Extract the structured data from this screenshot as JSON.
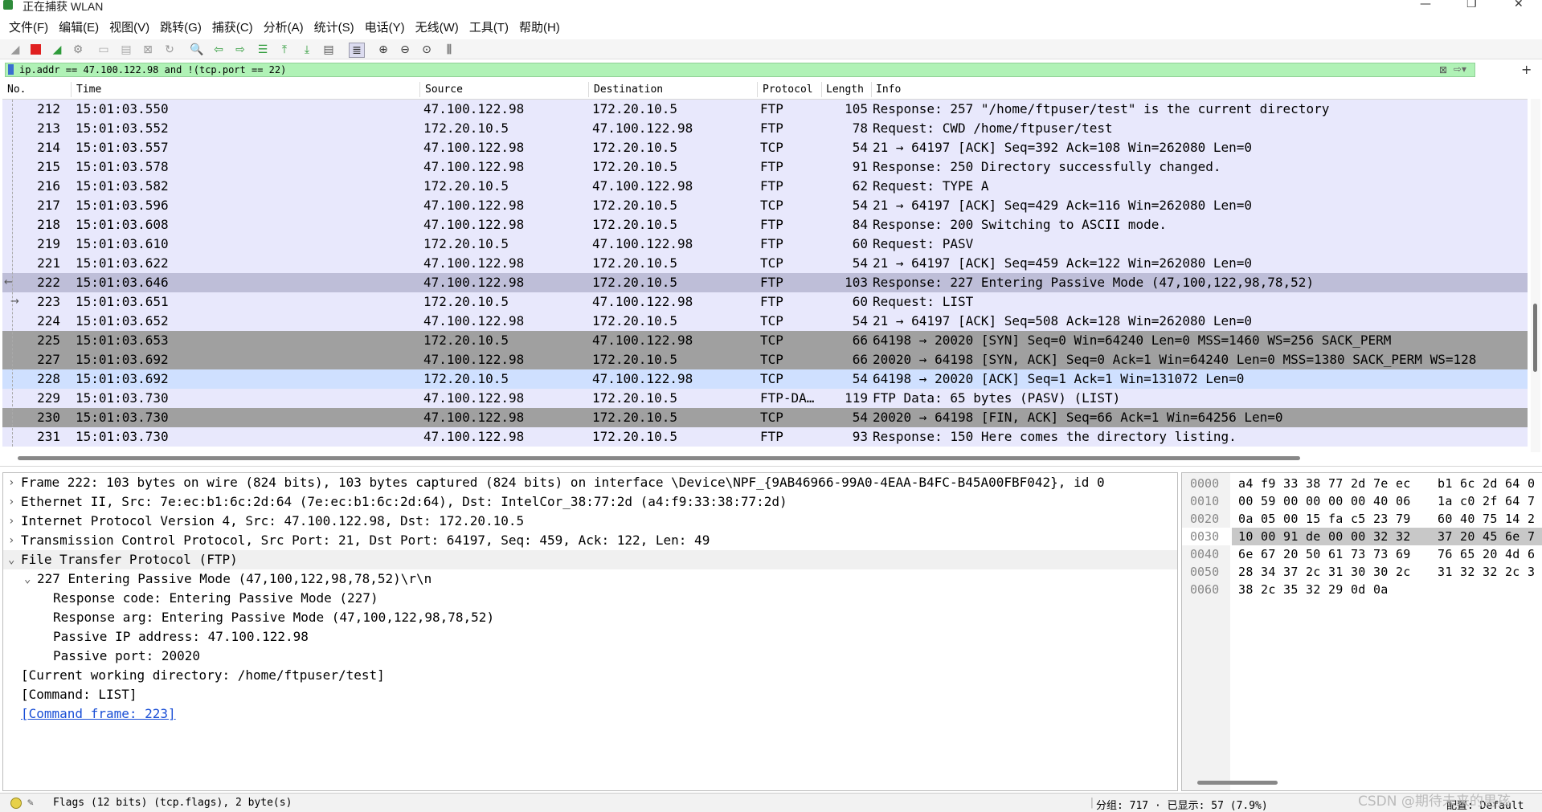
{
  "window": {
    "title": "正在捕获 WLAN",
    "minimize": "—",
    "maximize": "❐",
    "close": "✕"
  },
  "menu": [
    "文件(F)",
    "编辑(E)",
    "视图(V)",
    "跳转(G)",
    "捕获(C)",
    "分析(A)",
    "统计(S)",
    "电话(Y)",
    "无线(W)",
    "工具(T)",
    "帮助(H)"
  ],
  "filter": {
    "value": "ip.addr == 47.100.122.98 and !(tcp.port == 22)",
    "clear_icon": "⊠",
    "apply_icon": "⇨▾",
    "add": "+"
  },
  "columns": {
    "no": "No.",
    "time": "Time",
    "source": "Source",
    "destination": "Destination",
    "protocol": "Protocol",
    "length": "Length",
    "info": "Info"
  },
  "packets": [
    {
      "no": "212",
      "time": "15:01:03.550",
      "src": "47.100.122.98",
      "dst": "172.20.10.5",
      "proto": "FTP",
      "len": "105",
      "info": "Response: 257 \"/home/ftpuser/test\" is the current directory",
      "style": "ftp"
    },
    {
      "no": "213",
      "time": "15:01:03.552",
      "src": "172.20.10.5",
      "dst": "47.100.122.98",
      "proto": "FTP",
      "len": "78",
      "info": "Request: CWD /home/ftpuser/test",
      "style": "ftp"
    },
    {
      "no": "214",
      "time": "15:01:03.557",
      "src": "47.100.122.98",
      "dst": "172.20.10.5",
      "proto": "TCP",
      "len": "54",
      "info": "21 → 64197 [ACK] Seq=392 Ack=108 Win=262080 Len=0",
      "style": "ftp"
    },
    {
      "no": "215",
      "time": "15:01:03.578",
      "src": "47.100.122.98",
      "dst": "172.20.10.5",
      "proto": "FTP",
      "len": "91",
      "info": "Response: 250 Directory successfully changed.",
      "style": "ftp"
    },
    {
      "no": "216",
      "time": "15:01:03.582",
      "src": "172.20.10.5",
      "dst": "47.100.122.98",
      "proto": "FTP",
      "len": "62",
      "info": "Request: TYPE A",
      "style": "ftp"
    },
    {
      "no": "217",
      "time": "15:01:03.596",
      "src": "47.100.122.98",
      "dst": "172.20.10.5",
      "proto": "TCP",
      "len": "54",
      "info": "21 → 64197 [ACK] Seq=429 Ack=116 Win=262080 Len=0",
      "style": "ftp"
    },
    {
      "no": "218",
      "time": "15:01:03.608",
      "src": "47.100.122.98",
      "dst": "172.20.10.5",
      "proto": "FTP",
      "len": "84",
      "info": "Response: 200 Switching to ASCII mode.",
      "style": "ftp"
    },
    {
      "no": "219",
      "time": "15:01:03.610",
      "src": "172.20.10.5",
      "dst": "47.100.122.98",
      "proto": "FTP",
      "len": "60",
      "info": "Request: PASV",
      "style": "ftp"
    },
    {
      "no": "221",
      "time": "15:01:03.622",
      "src": "47.100.122.98",
      "dst": "172.20.10.5",
      "proto": "TCP",
      "len": "54",
      "info": "21 → 64197 [ACK] Seq=459 Ack=122 Win=262080 Len=0",
      "style": "ftp"
    },
    {
      "no": "222",
      "time": "15:01:03.646",
      "src": "47.100.122.98",
      "dst": "172.20.10.5",
      "proto": "FTP",
      "len": "103",
      "info": "Response: 227 Entering Passive Mode (47,100,122,98,78,52)",
      "style": "selected"
    },
    {
      "no": "223",
      "time": "15:01:03.651",
      "src": "172.20.10.5",
      "dst": "47.100.122.98",
      "proto": "FTP",
      "len": "60",
      "info": "Request: LIST",
      "style": "ftp"
    },
    {
      "no": "224",
      "time": "15:01:03.652",
      "src": "47.100.122.98",
      "dst": "172.20.10.5",
      "proto": "TCP",
      "len": "54",
      "info": "21 → 64197 [ACK] Seq=508 Ack=128 Win=262080 Len=0",
      "style": "ftp"
    },
    {
      "no": "225",
      "time": "15:01:03.653",
      "src": "172.20.10.5",
      "dst": "47.100.122.98",
      "proto": "TCP",
      "len": "66",
      "info": "64198 → 20020 [SYN] Seq=0 Win=64240 Len=0 MSS=1460 WS=256 SACK_PERM",
      "style": "syn"
    },
    {
      "no": "227",
      "time": "15:01:03.692",
      "src": "47.100.122.98",
      "dst": "172.20.10.5",
      "proto": "TCP",
      "len": "66",
      "info": "20020 → 64198 [SYN, ACK] Seq=0 Ack=1 Win=64240 Len=0 MSS=1380 SACK_PERM WS=128",
      "style": "syn"
    },
    {
      "no": "228",
      "time": "15:01:03.692",
      "src": "172.20.10.5",
      "dst": "47.100.122.98",
      "proto": "TCP",
      "len": "54",
      "info": "64198 → 20020 [ACK] Seq=1 Ack=1 Win=131072 Len=0",
      "style": "tcp"
    },
    {
      "no": "229",
      "time": "15:01:03.730",
      "src": "47.100.122.98",
      "dst": "172.20.10.5",
      "proto": "FTP-DA…",
      "len": "119",
      "info": "FTP Data: 65 bytes (PASV) (LIST)",
      "style": "ftp"
    },
    {
      "no": "230",
      "time": "15:01:03.730",
      "src": "47.100.122.98",
      "dst": "172.20.10.5",
      "proto": "TCP",
      "len": "54",
      "info": "20020 → 64198 [FIN, ACK] Seq=66 Ack=1 Win=64256 Len=0",
      "style": "syn"
    },
    {
      "no": "231",
      "time": "15:01:03.730",
      "src": "47.100.122.98",
      "dst": "172.20.10.5",
      "proto": "FTP",
      "len": "93",
      "info": "Response: 150 Here comes the directory listing.",
      "style": "ftp"
    }
  ],
  "details": [
    {
      "arrow": "›",
      "indent": 0,
      "text": "Frame 222: 103 bytes on wire (824 bits), 103 bytes captured (824 bits) on interface \\Device\\NPF_{9AB46966-99A0-4EAA-B4FC-B45A00FBF042}, id 0"
    },
    {
      "arrow": "›",
      "indent": 0,
      "text": "Ethernet II, Src: 7e:ec:b1:6c:2d:64 (7e:ec:b1:6c:2d:64), Dst: IntelCor_38:77:2d (a4:f9:33:38:77:2d)"
    },
    {
      "arrow": "›",
      "indent": 0,
      "text": "Internet Protocol Version 4, Src: 47.100.122.98, Dst: 172.20.10.5"
    },
    {
      "arrow": "›",
      "indent": 0,
      "text": "Transmission Control Protocol, Src Port: 21, Dst Port: 64197, Seq: 459, Ack: 122, Len: 49"
    },
    {
      "arrow": "⌄",
      "indent": 0,
      "text": "File Transfer Protocol (FTP)"
    },
    {
      "arrow": "⌄",
      "indent": 1,
      "text": "227 Entering Passive Mode (47,100,122,98,78,52)\\r\\n"
    },
    {
      "arrow": "",
      "indent": 2,
      "text": "Response code: Entering Passive Mode (227)"
    },
    {
      "arrow": "",
      "indent": 2,
      "text": "Response arg: Entering Passive Mode (47,100,122,98,78,52)"
    },
    {
      "arrow": "",
      "indent": 2,
      "text": "Passive IP address: 47.100.122.98"
    },
    {
      "arrow": "",
      "indent": 2,
      "text": "Passive port: 20020"
    },
    {
      "arrow": "",
      "indent": 0,
      "text": "[Current working directory: /home/ftpuser/test]"
    },
    {
      "arrow": "",
      "indent": 0,
      "text": "[Command: LIST]"
    },
    {
      "arrow": "",
      "indent": 0,
      "text": "[Command frame: 223]",
      "link": true
    }
  ],
  "bytes": [
    {
      "off": "0000",
      "hex1": "a4 f9 33 38 77 2d 7e ec",
      "hex2": "b1 6c 2d 64 0"
    },
    {
      "off": "0010",
      "hex1": "00 59 00 00 00 00 40 06",
      "hex2": "1a c0 2f 64 7"
    },
    {
      "off": "0020",
      "hex1": "0a 05 00 15 fa c5 23 79",
      "hex2": "60 40 75 14 2"
    },
    {
      "off": "0030",
      "hex1": "10 00 91 de 00 00 32 32",
      "hex2": "37 20 45 6e 7"
    },
    {
      "off": "0040",
      "hex1": "6e 67 20 50 61 73 73 69",
      "hex2": "76 65 20 4d 6"
    },
    {
      "off": "0050",
      "hex1": "28 34 37 2c 31 30 30 2c",
      "hex2": "31 32 32 2c 3"
    },
    {
      "off": "0060",
      "hex1": "38 2c 35 32 29 0d 0a",
      "hex2": ""
    }
  ],
  "status": {
    "field": "Flags (12 bits) (tcp.flags), 2 byte(s)",
    "packets": "分组: 717 · 已显示: 57 (7.9%)",
    "profile": "配置: Default"
  },
  "watermark": "CSDN @期待未来的男孩",
  "colors": {
    "ftp": "#e8e8fc",
    "selected": "#bebed8",
    "syn": "#a0a0a0",
    "tcp": "#cfe0ff",
    "filter_ok": "#b0f2b6"
  }
}
